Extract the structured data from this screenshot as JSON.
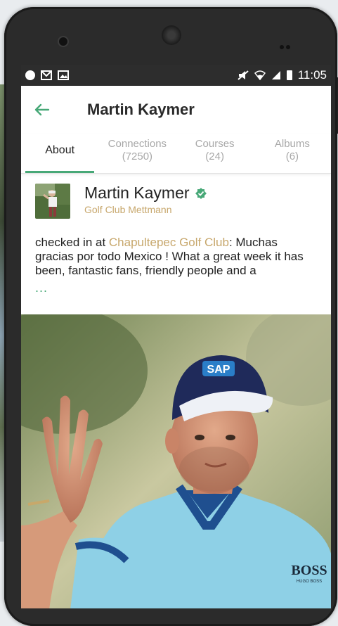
{
  "status_bar": {
    "time": "11:05"
  },
  "header": {
    "title": "Martin Kaymer"
  },
  "tabs": [
    {
      "label": "About",
      "count": ""
    },
    {
      "label": "Connections",
      "count": "(7250)"
    },
    {
      "label": "Courses",
      "count": "(24)"
    },
    {
      "label": "Albums",
      "count": "(6)"
    }
  ],
  "post": {
    "author": "Martin Kaymer",
    "club": "Golf Club Mettmann",
    "text_prefix": "checked in at ",
    "location": "Chapultepec Golf Club",
    "text_body": ": Muchas gracias por todo Mexico ! What a great week it has been, fantastic fans, friendly people and a",
    "more": "...",
    "photo": {
      "cap_logo": "SAP",
      "shirt_logo": "BOSS",
      "shirt_sub": "HUGO BOSS"
    }
  },
  "colors": {
    "accent_green": "#47a877",
    "gold": "#c7a76c",
    "status_bar": "#2d2d2d"
  },
  "icons": [
    "back-arrow-icon",
    "verified-badge-icon",
    "skype-icon",
    "mail-icon",
    "image-icon",
    "mute-icon",
    "wifi-icon",
    "signal-icon",
    "battery-icon"
  ]
}
